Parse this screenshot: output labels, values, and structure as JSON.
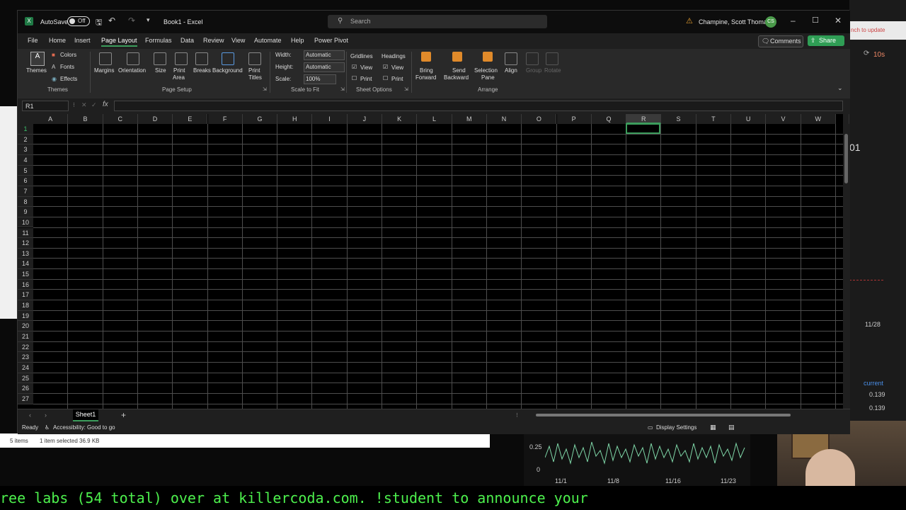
{
  "excel": {
    "title_bar": {
      "autosave_label": "AutoSave",
      "autosave_state": "Off",
      "doc_title": "Book1 - Excel",
      "search_placeholder": "Search",
      "user_name": "Champine, Scott Thomas",
      "user_initials": "CS"
    },
    "menu": [
      "File",
      "Home",
      "Insert",
      "Page Layout",
      "Formulas",
      "Data",
      "Review",
      "View",
      "Automate",
      "Help",
      "Power Pivot"
    ],
    "menu_active": "Page Layout",
    "comments_label": "Comments",
    "share_label": "Share",
    "ribbon": {
      "themes": {
        "themes": "Themes",
        "colors": "Colors",
        "fonts": "Fonts",
        "effects": "Effects",
        "group": "Themes"
      },
      "page_setup": {
        "margins": "Margins",
        "orientation": "Orientation",
        "size": "Size",
        "print_area_1": "Print",
        "print_area_2": "Area",
        "breaks": "Breaks",
        "background": "Background",
        "print_titles_1": "Print",
        "print_titles_2": "Titles",
        "group": "Page Setup"
      },
      "scale": {
        "width_label": "Width:",
        "width_value": "Automatic",
        "height_label": "Height:",
        "height_value": "Automatic",
        "scale_label": "Scale:",
        "scale_value": "100%",
        "group": "Scale to Fit"
      },
      "sheet_options": {
        "gridlines": "Gridlines",
        "headings": "Headings",
        "view": "View",
        "print": "Print",
        "group": "Sheet Options"
      },
      "arrange": {
        "bring_1": "Bring",
        "bring_2": "Forward",
        "send_1": "Send",
        "send_2": "Backward",
        "sel_1": "Selection",
        "sel_2": "Pane",
        "align": "Align",
        "group_btn": "Group",
        "rotate": "Rotate",
        "group": "Arrange"
      }
    },
    "name_box": "R1",
    "fx": "fx",
    "columns": [
      "A",
      "B",
      "C",
      "D",
      "E",
      "F",
      "G",
      "H",
      "I",
      "J",
      "K",
      "L",
      "M",
      "N",
      "O",
      "P",
      "Q",
      "R",
      "S",
      "T",
      "U",
      "V",
      "W"
    ],
    "rows": [
      "1",
      "2",
      "3",
      "4",
      "5",
      "6",
      "7",
      "8",
      "9",
      "10",
      "11",
      "12",
      "13",
      "14",
      "15",
      "16",
      "17",
      "18",
      "19",
      "20",
      "21",
      "22",
      "23",
      "24",
      "25",
      "26",
      "27"
    ],
    "selected_cell": "R1",
    "sheet_tab": "Sheet1",
    "status": {
      "ready": "Ready",
      "accessibility": "Accessibility: Good to go",
      "display_settings": "Display Settings"
    }
  },
  "background": {
    "explorer_items": "5 items",
    "explorer_selected": "1 item selected  36.9 KB",
    "right_panel": {
      "refresh": "10s",
      "value_01": "01",
      "date": "11/28",
      "current_label": "current",
      "current_1": "0.139",
      "current_2": "0.139",
      "update_hint": "nch to update"
    },
    "chart": {
      "y_025": "0.25",
      "y_0": "0",
      "dates": [
        "11/1",
        "11/8",
        "11/16",
        "11/23"
      ]
    },
    "ticker": "ree labs (54 total) over at killercoda.com. !student to announce your"
  }
}
